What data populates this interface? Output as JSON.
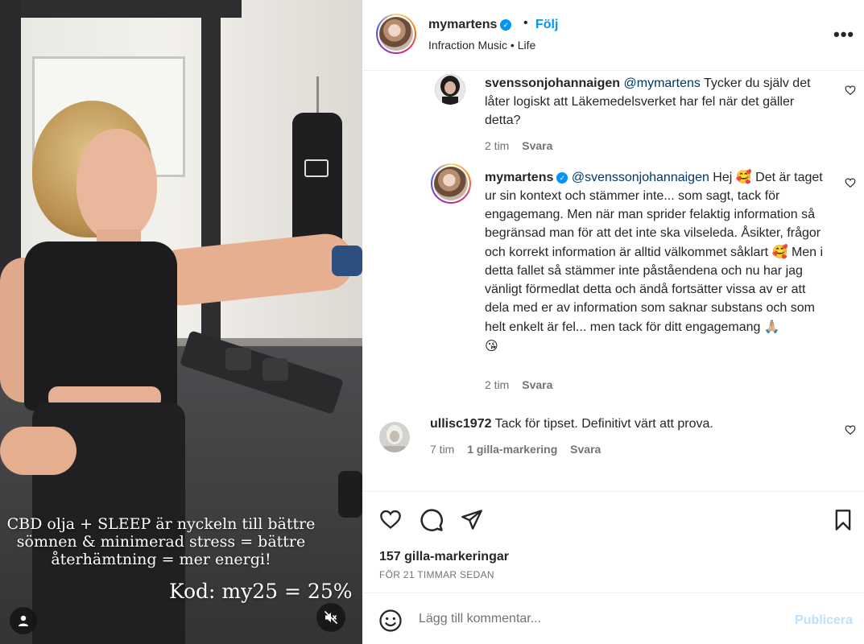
{
  "media": {
    "caption": "CBD olja + SLEEP är nyckeln till bättre sömnen & minimerad stress = bättre återhämtning = mer energi!",
    "code": "Kod: my25 = 25%",
    "tag_icon": "user-tag-icon",
    "mute_icon": "speaker-muted-icon"
  },
  "header": {
    "username": "mymartens",
    "separator": "•",
    "follow_label": "Följ",
    "subtitle": "Infraction Music • Life",
    "more_icon": "more-dots-icon",
    "more_label": "•••"
  },
  "comments": [
    {
      "username": "svenssonjohannaigen",
      "mention": "@mymartens",
      "text": " Tycker du själv det låter logiskt att Läkemedelsverket har fel när det gäller detta?",
      "time": "2 tim",
      "reply_label": "Svara"
    },
    {
      "username": "mymartens",
      "mention": "@svenssonjohannaigen",
      "text_1": " Hej ",
      "emoji_1": "🥰",
      "text_2": " Det är taget ur sin kontext och stämmer inte... som sagt, tack för engagemang. Men när man sprider felaktig information så begränsad man för att det inte ska vilseleda. Åsikter, frågor och korrekt information är alltid välkommet såklart ",
      "emoji_2": "🥰",
      "text_3": " Men i detta fallet så stämmer inte påståendena och nu har jag vänligt förmedlat detta och ändå fortsätter vissa av er att dela med er av information som saknar substans och som helt enkelt är fel... men tack för ditt engagemang ",
      "emoji_3": "🙏🏼",
      "emoji_4": "😘",
      "time": "2 tim",
      "reply_label": "Svara"
    },
    {
      "username": "ullisc1972",
      "text": " Tack för tipset. Definitivt värt att prova.",
      "time": "7 tim",
      "likes_label": "1 gilla-markering",
      "reply_label": "Svara"
    }
  ],
  "actions": {
    "like_icon": "heart-icon",
    "comment_icon": "comment-icon",
    "share_icon": "paper-plane-icon",
    "save_icon": "bookmark-icon",
    "likes": "157 gilla-markeringar",
    "time": "FÖR 21 TIMMAR SEDAN"
  },
  "add_comment": {
    "emoji_icon": "smiley-icon",
    "placeholder": "Lägg till kommentar...",
    "publish_label": "Publicera"
  },
  "colors": {
    "accent": "#0095f6",
    "text": "#262626",
    "muted": "#737373",
    "publish_disabled": "#c0dffd",
    "mention": "#00376b"
  }
}
